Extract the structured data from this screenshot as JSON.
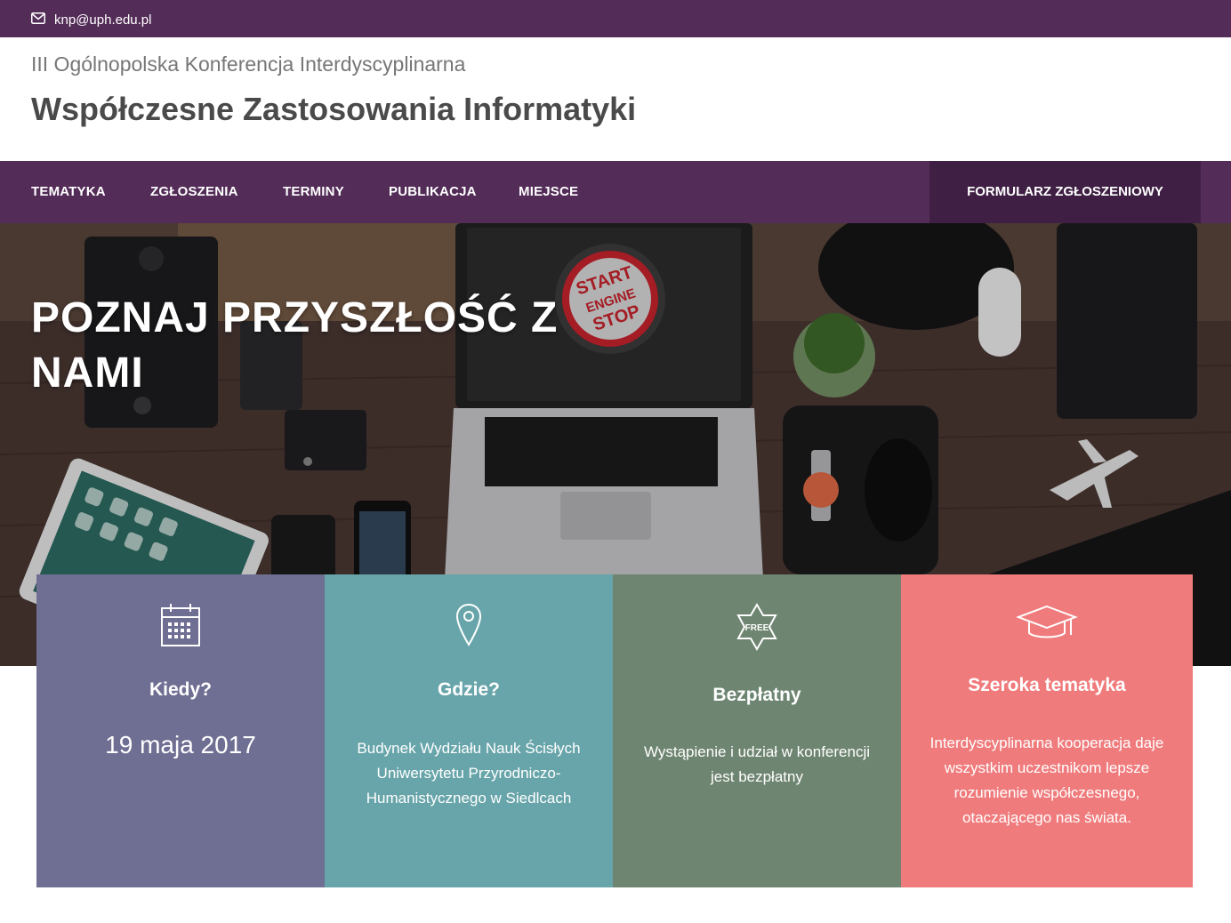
{
  "topbar": {
    "email": "knp@uph.edu.pl",
    "email_icon": "envelope-icon"
  },
  "brand": {
    "subtitle": "III Ogólnopolska Konferencja Interdyscyplinarna",
    "title": "Współczesne Zastosowania Informatyki"
  },
  "nav": {
    "items": [
      "TEMATYKA",
      "ZGŁOSZENIA",
      "TERMINY",
      "PUBLIKACJA",
      "MIEJSCE"
    ],
    "cta": "FORMULARZ ZGŁOSZENIOWY"
  },
  "hero": {
    "headline": "POZNAJ PRZYSZŁOŚĆ Z NAMI",
    "button_text": [
      "START",
      "ENGINE",
      "STOP"
    ]
  },
  "cards": [
    {
      "icon": "calendar-icon",
      "title": "Kiedy?",
      "value": "19 maja 2017",
      "color": "#6f6e93"
    },
    {
      "icon": "map-pin-icon",
      "title": "Gdzie?",
      "text": "Budynek Wydziału Nauk Ścisłych Uniwersytetu Przyrodniczo-Humanistycznego w Siedlcach",
      "color": "#68a5aa"
    },
    {
      "icon": "free-badge-icon",
      "icon_text": "FREE",
      "title": "Bezpłatny",
      "text": "Wystąpienie i udział w konferencji jest bezpłatny",
      "color": "#6e8571"
    },
    {
      "icon": "graduation-cap-icon",
      "title": "Szeroka tematyka",
      "text": "Interdyscyplinarna kooperacja daje wszystkim uczestnikom lepsze rozumienie współczesnego, otaczającego nas świata.",
      "color": "#f07b7c"
    }
  ],
  "colors": {
    "brand_purple": "#532c58",
    "cta_purple": "#3f2044"
  }
}
